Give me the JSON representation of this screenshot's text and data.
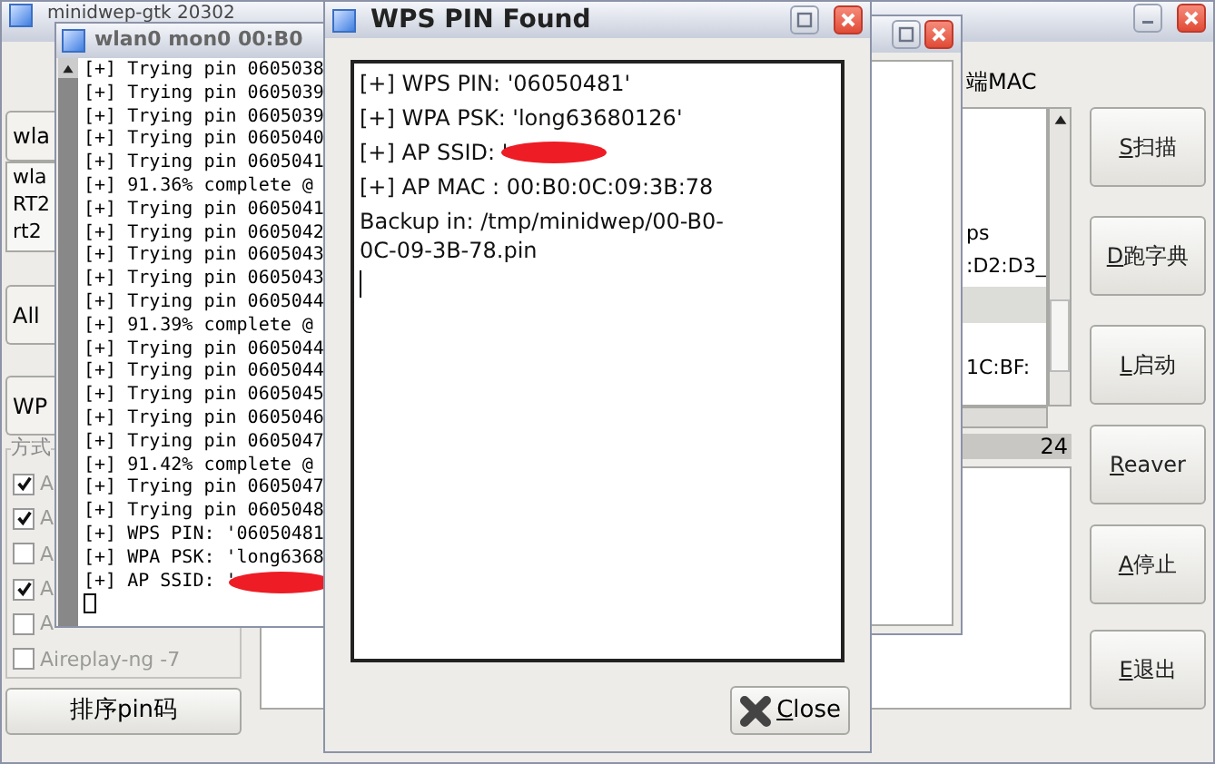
{
  "main_window": {
    "title": "minidwep-gtk 20302",
    "interface_button": "wla",
    "interface_list": [
      "wla",
      "RT2",
      "rt2"
    ],
    "channel_button": "All",
    "encryption_button": "WP",
    "method_group": {
      "label": "方式",
      "options": [
        {
          "label": "A",
          "checked": true
        },
        {
          "label": "A",
          "checked": true
        },
        {
          "label": "A",
          "checked": false
        },
        {
          "label": "A",
          "checked": true
        },
        {
          "label": "A",
          "checked": false
        },
        {
          "label": "Aireplay-ng -7",
          "checked": false
        }
      ]
    },
    "sort_button": "排序pin码",
    "client_mac_header": "端MAC",
    "ap_list": [
      "ps",
      ":D2:D3_",
      "1C:BF:"
    ],
    "count": "24",
    "buttons": [
      {
        "key": "S",
        "text": "扫描"
      },
      {
        "key": "D",
        "text": "跑字典"
      },
      {
        "key": "L",
        "text": "启动"
      },
      {
        "key": "R",
        "text": "eaver"
      },
      {
        "key": "A",
        "text": "停止"
      },
      {
        "key": "E",
        "text": "退出"
      }
    ]
  },
  "terminal_window": {
    "title": "wlan0 mon0 00:B0",
    "lines": [
      {
        "text": "[+] Trying pin 0605038",
        "redacted": false
      },
      {
        "text": "[+] Trying pin 0605039",
        "redacted": false
      },
      {
        "text": "[+] Trying pin 0605039",
        "redacted": false
      },
      {
        "text": "[+] Trying pin 0605040",
        "redacted": false
      },
      {
        "text": "[+] Trying pin 0605041",
        "redacted": false
      },
      {
        "text": "[+] 91.36% complete @",
        "redacted": false
      },
      {
        "text": "[+] Trying pin 0605041",
        "redacted": false
      },
      {
        "text": "[+] Trying pin 0605042",
        "redacted": false
      },
      {
        "text": "[+] Trying pin 0605043",
        "redacted": false
      },
      {
        "text": "[+] Trying pin 0605043",
        "redacted": false
      },
      {
        "text": "[+] Trying pin 0605044",
        "redacted": false
      },
      {
        "text": "[+] 91.39% complete @",
        "redacted": false
      },
      {
        "text": "[+] Trying pin 0605044",
        "redacted": false
      },
      {
        "text": "[+] Trying pin 0605044",
        "redacted": false
      },
      {
        "text": "[+] Trying pin 0605045",
        "redacted": false
      },
      {
        "text": "[+] Trying pin 0605046",
        "redacted": false
      },
      {
        "text": "[+] Trying pin 0605047",
        "redacted": false
      },
      {
        "text": "[+] 91.42% complete @",
        "redacted": false
      },
      {
        "text": "[+] Trying pin 0605047",
        "redacted": false
      },
      {
        "text": "[+] Trying pin 0605048",
        "redacted": false
      },
      {
        "text": "[+] WPS PIN: '06050481",
        "redacted": false
      },
      {
        "text": "[+] WPA PSK: 'long6368",
        "redacted": false
      },
      {
        "text": "[+] AP SSID: '",
        "redacted": true
      }
    ]
  },
  "pin_dialog": {
    "title": "WPS PIN Found",
    "lines": [
      {
        "text": "[+] WPS PIN: '06050481'",
        "redacted": false
      },
      {
        "text": "[+] WPA PSK: 'long63680126'",
        "redacted": false
      },
      {
        "text": "[+] AP SSID: '",
        "redacted": true
      },
      {
        "text": "[+] AP MAC : 00:B0:0C:09:3B:78",
        "redacted": false
      },
      {
        "text": "Backup in: /tmp/minidwep/00-B0-0C-09-3B-78.pin",
        "redacted": false
      }
    ],
    "close_button": {
      "key": "C",
      "text": "lose"
    }
  }
}
